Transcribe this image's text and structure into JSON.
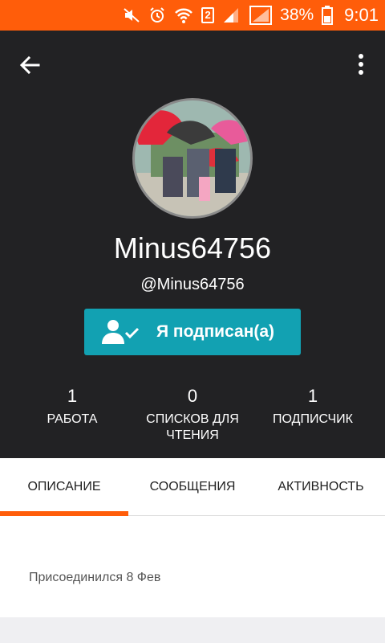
{
  "status_bar": {
    "battery_percent": "38%",
    "time": "9:01",
    "sim_slot": "2",
    "background_color": "#ff5d0a"
  },
  "toolbar": {
    "back_icon": "arrow-left-icon",
    "more_icon": "more-vertical-icon"
  },
  "profile": {
    "display_name": "Minus64756",
    "username": "@Minus64756",
    "follow_button_label": "Я подписан(а)",
    "follow_button_color": "#12a1b2"
  },
  "stats": [
    {
      "value": "1",
      "label": "РАБОТА"
    },
    {
      "value": "0",
      "label": "СПИСКОВ ДЛЯ ЧТЕНИЯ"
    },
    {
      "value": "1",
      "label": "ПОДПИСЧИК"
    }
  ],
  "tabs": [
    {
      "label": "ОПИСАНИЕ",
      "active": true
    },
    {
      "label": "СООБЩЕНИЯ",
      "active": false
    },
    {
      "label": "АКТИВНОСТЬ",
      "active": false
    }
  ],
  "about": {
    "joined_text": "Присоединился 8 Фев"
  },
  "accent_color": "#ff5d0a"
}
